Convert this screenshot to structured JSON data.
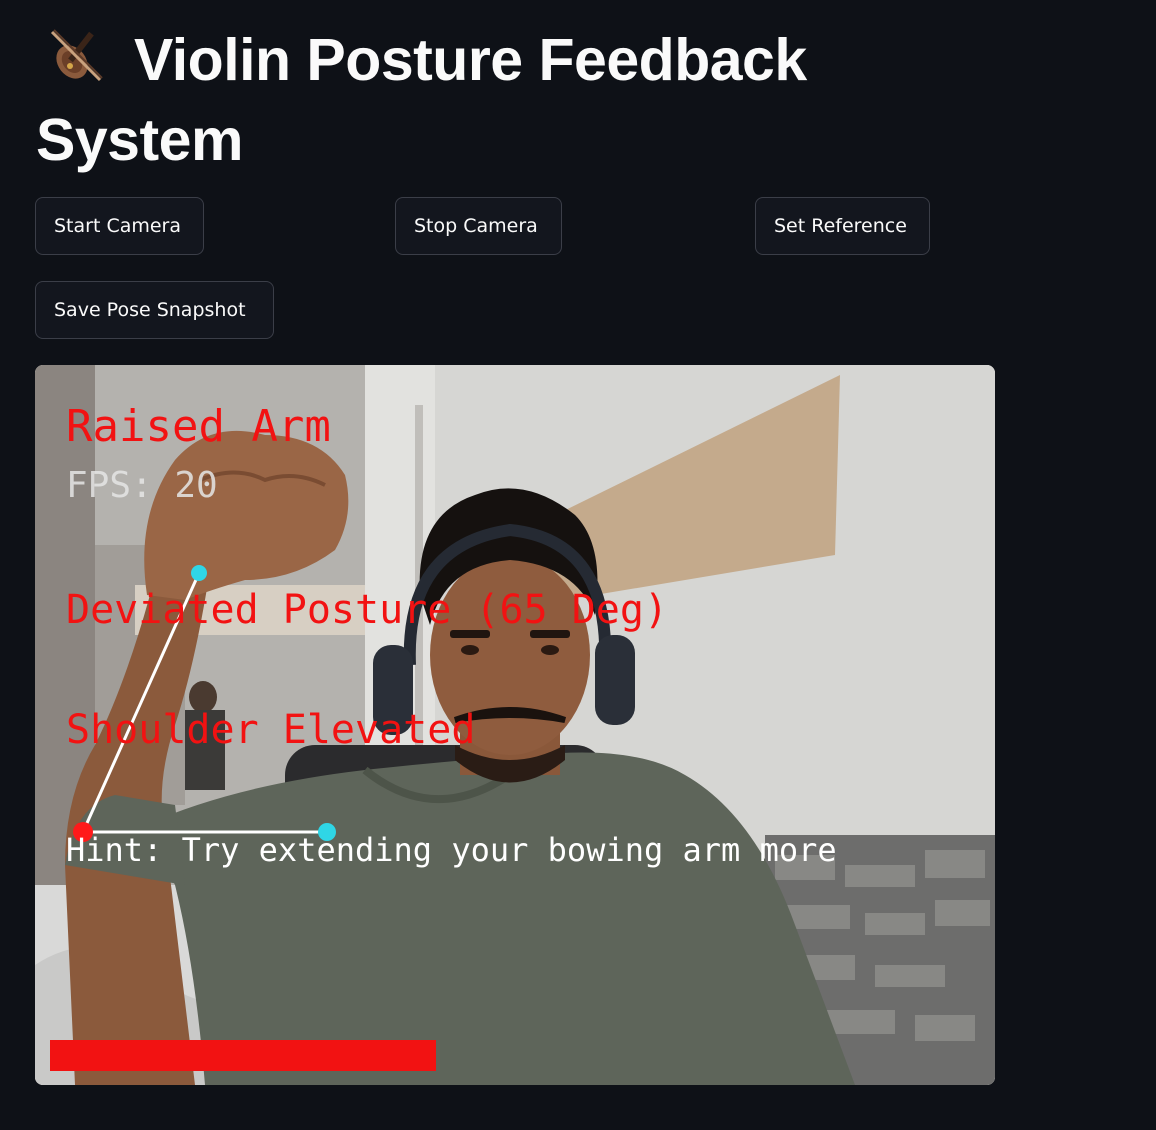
{
  "app": {
    "title": "Violin Posture Feedback System",
    "title_icon": "violin-emoji-icon"
  },
  "buttons": {
    "start_camera": "Start Camera",
    "stop_camera": "Stop Camera",
    "set_reference": "Set Reference",
    "save_snapshot": "Save Pose Snapshot"
  },
  "feed": {
    "status_label": "Raised Arm",
    "fps_label": "FPS: 20",
    "deviation_label": "Deviated Posture (65 Deg)",
    "shoulder_label": "Shoulder Elevated",
    "hint_label": "Hint: Try extending your bowing arm more",
    "progress_fraction": 0.4,
    "colors": {
      "alert_red": "#f21212",
      "keypoint_cyan": "#2fd6e6",
      "keypoint_red": "#ff1a1a",
      "skeleton_line": "#ffffff"
    }
  },
  "theme": {
    "background": "#0e1117",
    "button_border": "#3b3e48",
    "text": "#fafafa"
  }
}
